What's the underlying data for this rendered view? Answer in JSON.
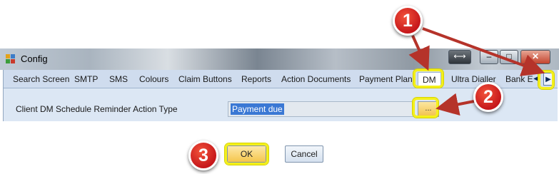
{
  "window": {
    "title": "Config",
    "buttons": {
      "resize": "⟷",
      "minimize": "–",
      "maximize": "□",
      "close": "✕"
    }
  },
  "tabs": [
    {
      "label": "Search Screen"
    },
    {
      "label": "SMTP"
    },
    {
      "label": "SMS"
    },
    {
      "label": "Colours"
    },
    {
      "label": "Claim Buttons"
    },
    {
      "label": "Reports"
    },
    {
      "label": "Action Documents"
    },
    {
      "label": "Payment Plan"
    },
    {
      "label": "DM",
      "active": true
    },
    {
      "label": "Ultra Dialler"
    },
    {
      "label": "Bank E"
    }
  ],
  "tab_scroll": {
    "left": "◀",
    "right": "▶"
  },
  "field": {
    "label": "Client DM Schedule Reminder Action Type",
    "value": "Payment due",
    "browse_label": "..."
  },
  "dialog_buttons": {
    "ok": "OK",
    "cancel": "Cancel"
  },
  "callouts": [
    "1",
    "2",
    "3"
  ],
  "colors": {
    "highlight": "#f4f01a",
    "callout": "#d11f1f",
    "arrow": "#b5332a"
  }
}
